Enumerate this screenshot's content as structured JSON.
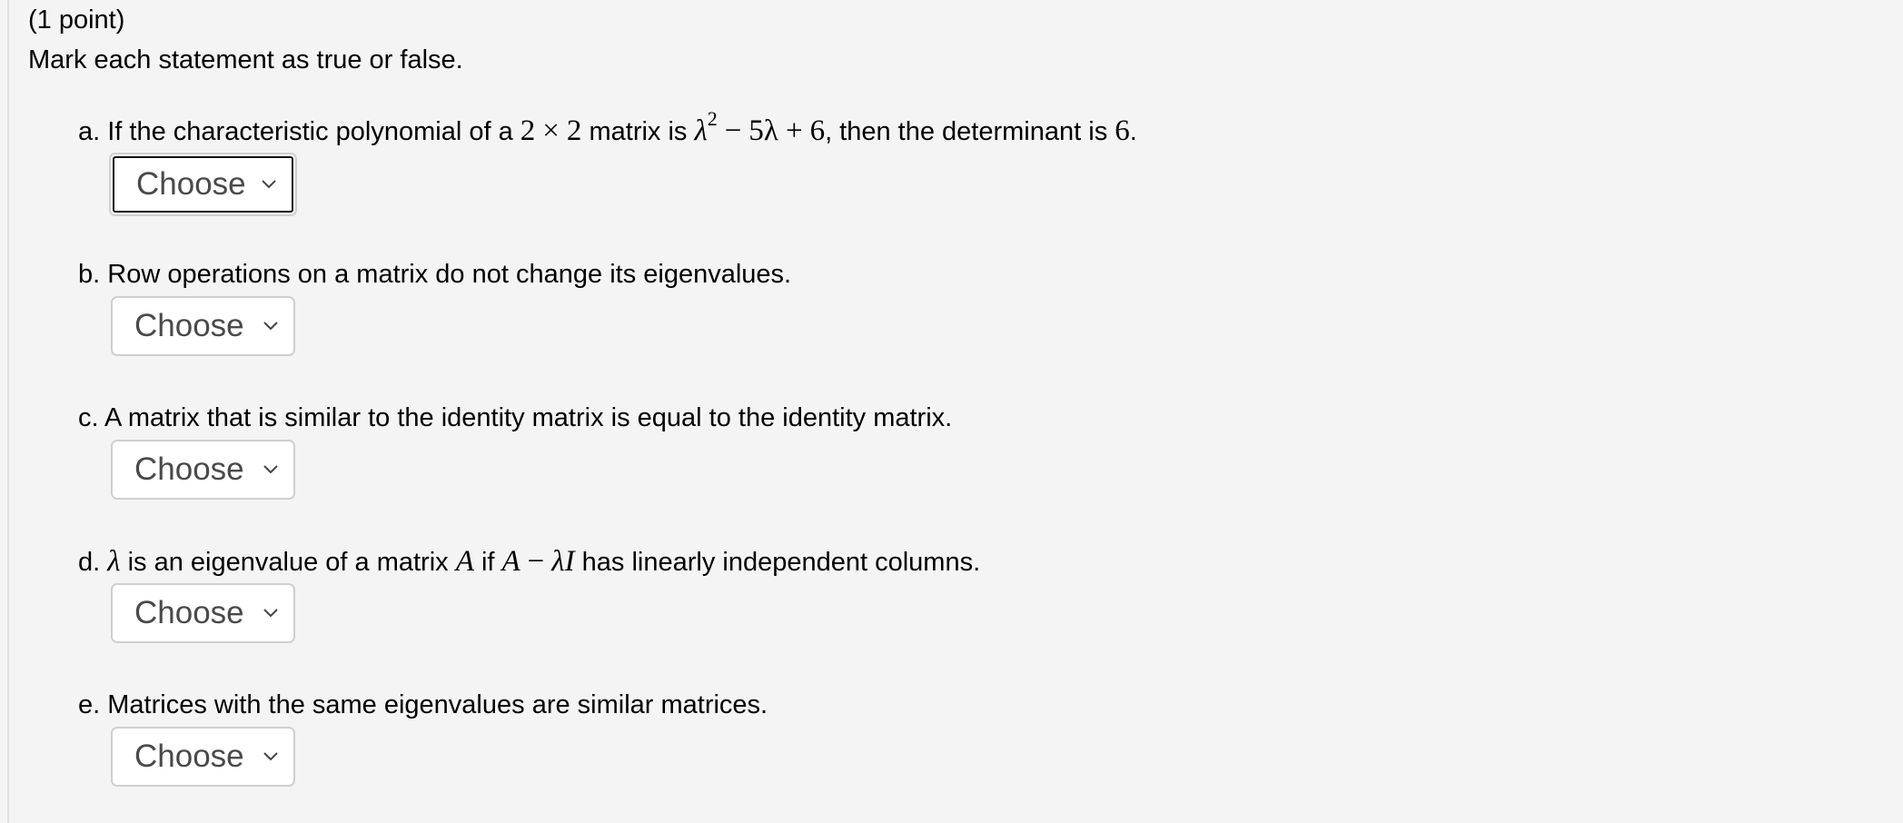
{
  "problem": {
    "points": "(1 point)",
    "instructions": "Mark each statement as true or false."
  },
  "items": [
    {
      "letter": "a.",
      "parts": {
        "t1": "If the characteristic polynomial of a",
        "m_two_a": "2",
        "m_times": "×",
        "m_two_b": "2",
        "t2": "matrix is",
        "m_lambda": "λ",
        "m_exp": "2",
        "m_minus": "−",
        "m_five_lambda": "5λ",
        "m_plus": "+",
        "m_six": "6",
        "t3": ", then the determinant is",
        "m_det": "6",
        "t4": "."
      },
      "select": {
        "value": "Choose",
        "focused": true
      }
    },
    {
      "letter": "b.",
      "text": "Row operations on a matrix do not change its eigenvalues.",
      "select": {
        "value": "Choose",
        "focused": false
      }
    },
    {
      "letter": "c.",
      "text": "A matrix that is similar to the identity matrix is equal to the identity matrix.",
      "select": {
        "value": "Choose",
        "focused": false
      }
    },
    {
      "letter": "d.",
      "parts": {
        "m_lambda": "λ",
        "t1": "is an eigenvalue of a matrix",
        "m_A": "A",
        "t2": "if",
        "m_A2": "A",
        "m_minus": "−",
        "m_lambdaI": "λI",
        "t3": "has linearly independent columns."
      },
      "select": {
        "value": "Choose",
        "focused": false
      }
    },
    {
      "letter": "e.",
      "text": "Matrices with the same eigenvalues are similar matrices.",
      "select": {
        "value": "Choose",
        "focused": false
      }
    }
  ],
  "icons": {
    "select_arrow": "chevron-down-icon"
  }
}
